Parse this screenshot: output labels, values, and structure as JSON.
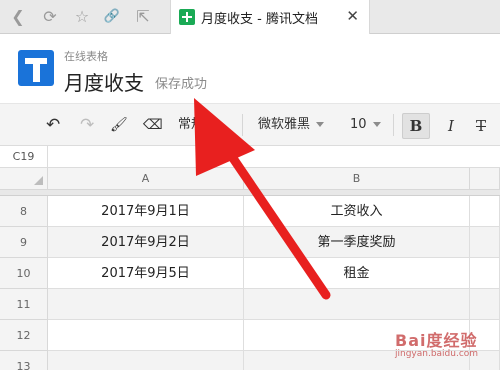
{
  "browser": {
    "tab_title": "月度收支 - 腾讯文档",
    "close_glyph": "✕",
    "back_glyph": "❮",
    "refresh_glyph": "⟳",
    "bookmark_glyph": "☆",
    "link_glyph": "🔗",
    "share_glyph": "⇱"
  },
  "header": {
    "subtitle": "在线表格",
    "title": "月度收支",
    "save_status": "保存成功"
  },
  "toolbar": {
    "undo_glyph": "↶",
    "redo_glyph": "↷",
    "paint_glyph": "🖌",
    "erase_glyph": "⌫",
    "number_format": "常规",
    "font_family": "微软雅黑",
    "font_size": "10",
    "bold_label": "B",
    "italic_label": "I",
    "strike_label": "T"
  },
  "formula_bar": {
    "cell_ref": "C19"
  },
  "sheet": {
    "columns": [
      "A",
      "B"
    ],
    "rows": [
      {
        "num": "8",
        "a": "2017年9月1日",
        "b": "工资收入"
      },
      {
        "num": "9",
        "a": "2017年9月2日",
        "b": "第一季度奖励"
      },
      {
        "num": "10",
        "a": "2017年9月5日",
        "b": "租金"
      },
      {
        "num": "11",
        "a": "",
        "b": ""
      },
      {
        "num": "12",
        "a": "",
        "b": ""
      },
      {
        "num": "13",
        "a": "",
        "b": ""
      }
    ]
  },
  "annotation": {
    "arrow_color": "#e8201f"
  },
  "watermark": {
    "logo": "Bai度经验",
    "url": "jingyan.baidu.com"
  }
}
